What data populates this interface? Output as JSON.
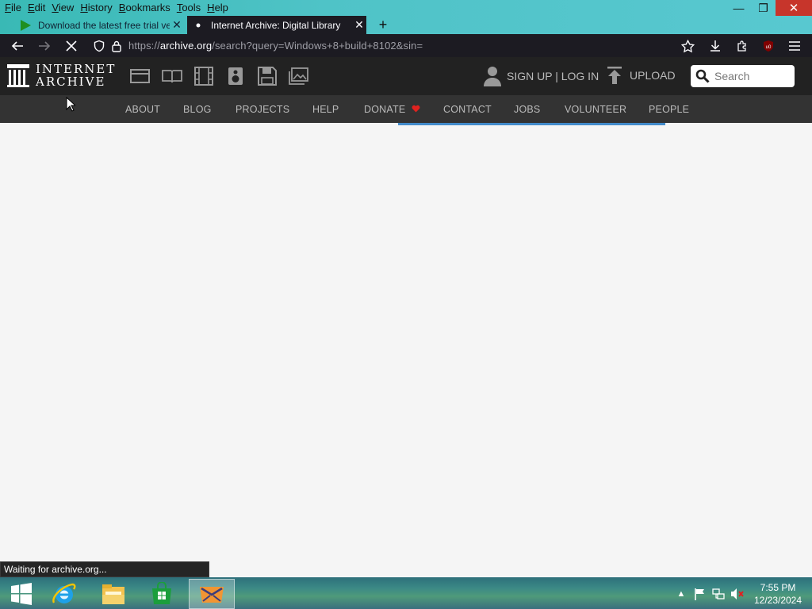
{
  "menubar": {
    "items": [
      {
        "label": "File",
        "acc": "F",
        "rest": "ile"
      },
      {
        "label": "Edit",
        "acc": "E",
        "rest": "dit"
      },
      {
        "label": "View",
        "acc": "V",
        "rest": "iew"
      },
      {
        "label": "History",
        "acc": "H",
        "rest": "istory"
      },
      {
        "label": "Bookmarks",
        "acc": "B",
        "rest": "ookmarks"
      },
      {
        "label": "Tools",
        "acc": "T",
        "rest": "ools"
      },
      {
        "label": "Help",
        "acc": "H",
        "rest": "elp"
      }
    ]
  },
  "window_controls": {
    "minimize": "—",
    "restore": "❐",
    "close": "✕"
  },
  "tabs": [
    {
      "label": "Download the latest free trial ve",
      "icon": "play-triangle-icon",
      "active": false
    },
    {
      "label": "Internet Archive: Digital Library",
      "icon": "loading-dot-icon",
      "active": true
    }
  ],
  "new_tab": "+",
  "url": {
    "scheme": "https://",
    "host": "archive.org",
    "path": "/search?query=Windows+8+build+8102&sin="
  },
  "ia": {
    "logo_line1": "INTERNET",
    "logo_line2": "ARCHIVE",
    "account_label": "SIGN UP | LOG IN",
    "upload_label": "UPLOAD",
    "search_placeholder": "Search",
    "nav": [
      "ABOUT",
      "BLOG",
      "PROJECTS",
      "HELP",
      "DONATE",
      "CONTACT",
      "JOBS",
      "VOLUNTEER",
      "PEOPLE"
    ]
  },
  "status_text": "Waiting for archive.org...",
  "taskbar": {
    "apps": [
      "start-icon",
      "internet-explorer-icon",
      "file-explorer-icon",
      "store-icon",
      "firefox-icon"
    ],
    "clock_time": "7:55 PM",
    "clock_date": "12/23/2024"
  },
  "colors": {
    "accent_teal": "#4fc3c7",
    "browser_dark": "#1c1b22",
    "ia_header": "#222222",
    "ia_nav": "#333333",
    "progress_blue": "#428bca",
    "donate_heart": "#e0221f"
  }
}
